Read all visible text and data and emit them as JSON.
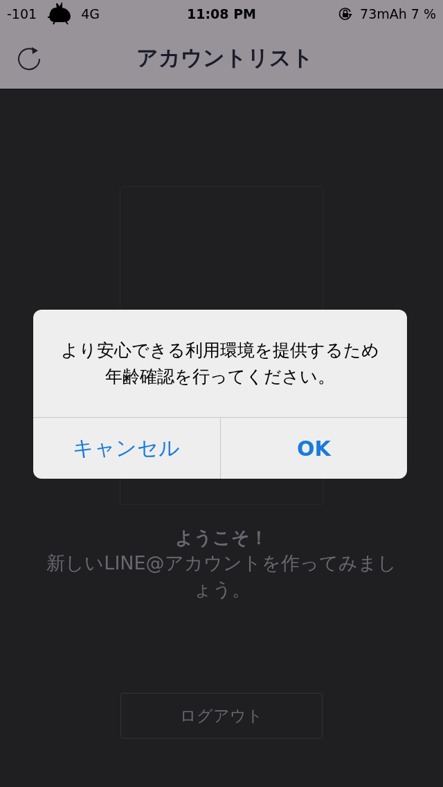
{
  "status_bar": {
    "signal": "-101",
    "network": "4G",
    "time": "11:08 PM",
    "battery": "73mAh 7 %"
  },
  "nav": {
    "title": "アカウントリスト"
  },
  "welcome": {
    "title": "ようこそ！",
    "message": "新しいLINE@アカウントを作ってみましょう。"
  },
  "logout_button": "ログアウト",
  "alert": {
    "message": "より安心できる利用環境を提供するため年齢確認を行ってください。",
    "buttons": [
      {
        "label": "キャンセル",
        "kind": "cancel"
      },
      {
        "label": "OK",
        "kind": "default"
      }
    ]
  }
}
